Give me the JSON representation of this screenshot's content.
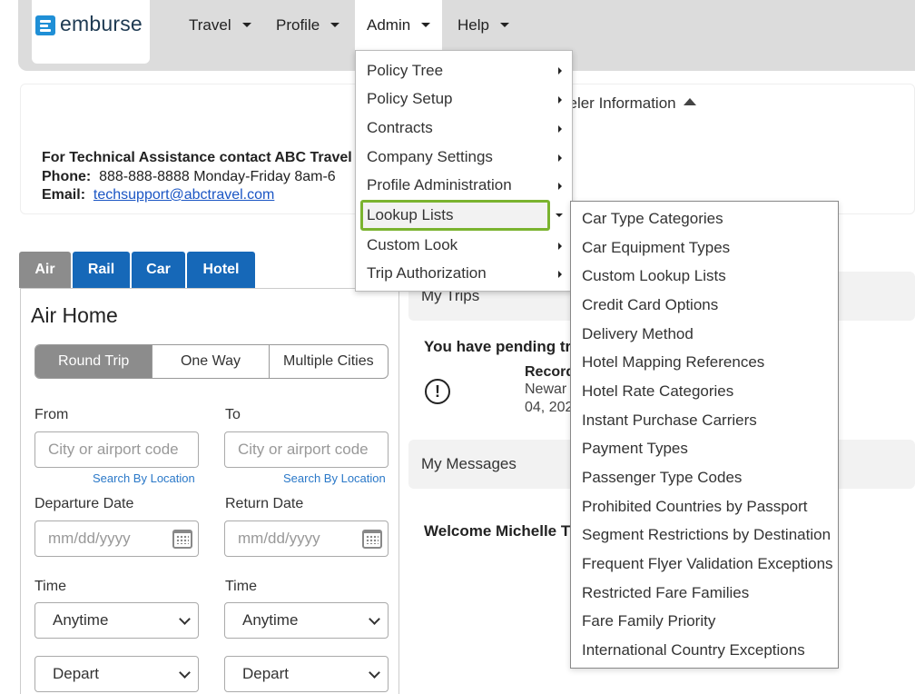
{
  "brand": {
    "logo_text": "emburse"
  },
  "nav": [
    {
      "label": "Travel"
    },
    {
      "label": "Profile"
    },
    {
      "label": "Admin"
    },
    {
      "label": "Help"
    }
  ],
  "info": {
    "line1": "For Technical Assistance contact ABC Travel",
    "phone_label": "Phone:",
    "phone_value": "888-888-8888 Monday-Friday 8am-6",
    "email_label": "Email:",
    "email_value": "techsupport@abctravel.com",
    "traveler_info": "veler Information"
  },
  "tabs": [
    {
      "label": "Air"
    },
    {
      "label": "Rail"
    },
    {
      "label": "Car"
    },
    {
      "label": "Hotel"
    }
  ],
  "air": {
    "title": "Air Home",
    "trip_types": [
      "Round Trip",
      "One Way",
      "Multiple Cities"
    ],
    "from_label": "From",
    "to_label": "To",
    "from_placeholder": "City or airport code",
    "to_placeholder": "City or airport code",
    "search_by_location": "Search By Location",
    "departure_label": "Departure Date",
    "return_label": "Return Date",
    "date_placeholder": "mm/dd/yyyy",
    "time_label": "Time",
    "time_value": "Anytime",
    "depart_value": "Depart"
  },
  "right": {
    "my_trips": "My Trips",
    "pending": "You have pending tri",
    "record": "Record",
    "record_city": "Newar",
    "record_date": "04, 202",
    "my_messages": "My Messages",
    "welcome": "Welcome Michelle Th"
  },
  "admin_menu": {
    "items": [
      "Policy Tree",
      "Policy Setup",
      "Contracts",
      "Company Settings",
      "Profile Administration",
      "Lookup Lists",
      "Custom Look",
      "Trip Authorization"
    ]
  },
  "lookup_lists": [
    "Car Type Categories",
    "Car Equipment Types",
    "Custom Lookup Lists",
    "Credit Card Options",
    "Delivery Method",
    "Hotel Mapping References",
    "Hotel Rate Categories",
    "Instant Purchase Carriers",
    "Payment Types",
    "Passenger Type Codes",
    "Prohibited Countries by Passport",
    "Segment Restrictions by Destination",
    "Frequent Flyer Validation Exceptions",
    "Restricted Fare Families",
    "Fare Family Priority",
    "International Country Exceptions"
  ],
  "colors": {
    "highlight_border": "#7ab32f",
    "tab_blue": "#1668b8",
    "tab_gray": "#8c8c8c",
    "logo_blue": "#1f8fd6"
  }
}
